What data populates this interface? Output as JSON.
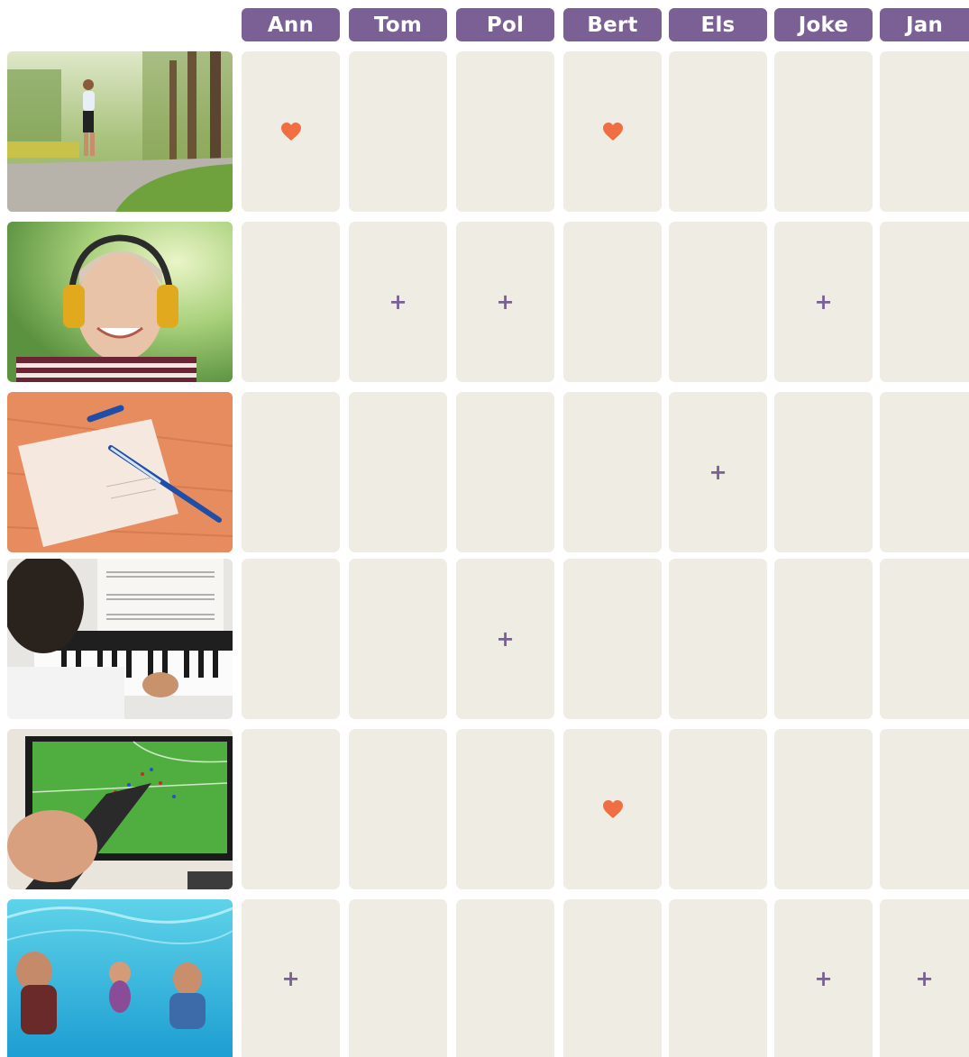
{
  "columns": [
    "Ann",
    "Tom",
    "Pol",
    "Bert",
    "Els",
    "Joke",
    "Jan"
  ],
  "symbols": {
    "plus": "+",
    "heart": "heart-icon"
  },
  "colors": {
    "header_bg": "#7a6094",
    "header_text": "#ffffff",
    "cell_bg": "#efece4",
    "plus": "#7a6094",
    "heart": "#ef6f43"
  },
  "rows": [
    {
      "activity_image": "jogging-photo",
      "marks": [
        "heart",
        "",
        "",
        "heart",
        "",
        "",
        ""
      ]
    },
    {
      "activity_image": "music-headphones-photo",
      "marks": [
        "",
        "plus",
        "plus",
        "",
        "",
        "plus",
        ""
      ]
    },
    {
      "activity_image": "writing-letter-photo",
      "marks": [
        "",
        "",
        "",
        "",
        "plus",
        "",
        ""
      ]
    },
    {
      "activity_image": "piano-playing-photo",
      "marks": [
        "",
        "",
        "plus",
        "",
        "",
        "",
        ""
      ]
    },
    {
      "activity_image": "watching-football-tv-photo",
      "marks": [
        "",
        "",
        "",
        "heart",
        "",
        "",
        ""
      ]
    },
    {
      "activity_image": "swimming-underwater-photo",
      "marks": [
        "plus",
        "",
        "",
        "",
        "",
        "plus",
        "plus"
      ]
    }
  ]
}
